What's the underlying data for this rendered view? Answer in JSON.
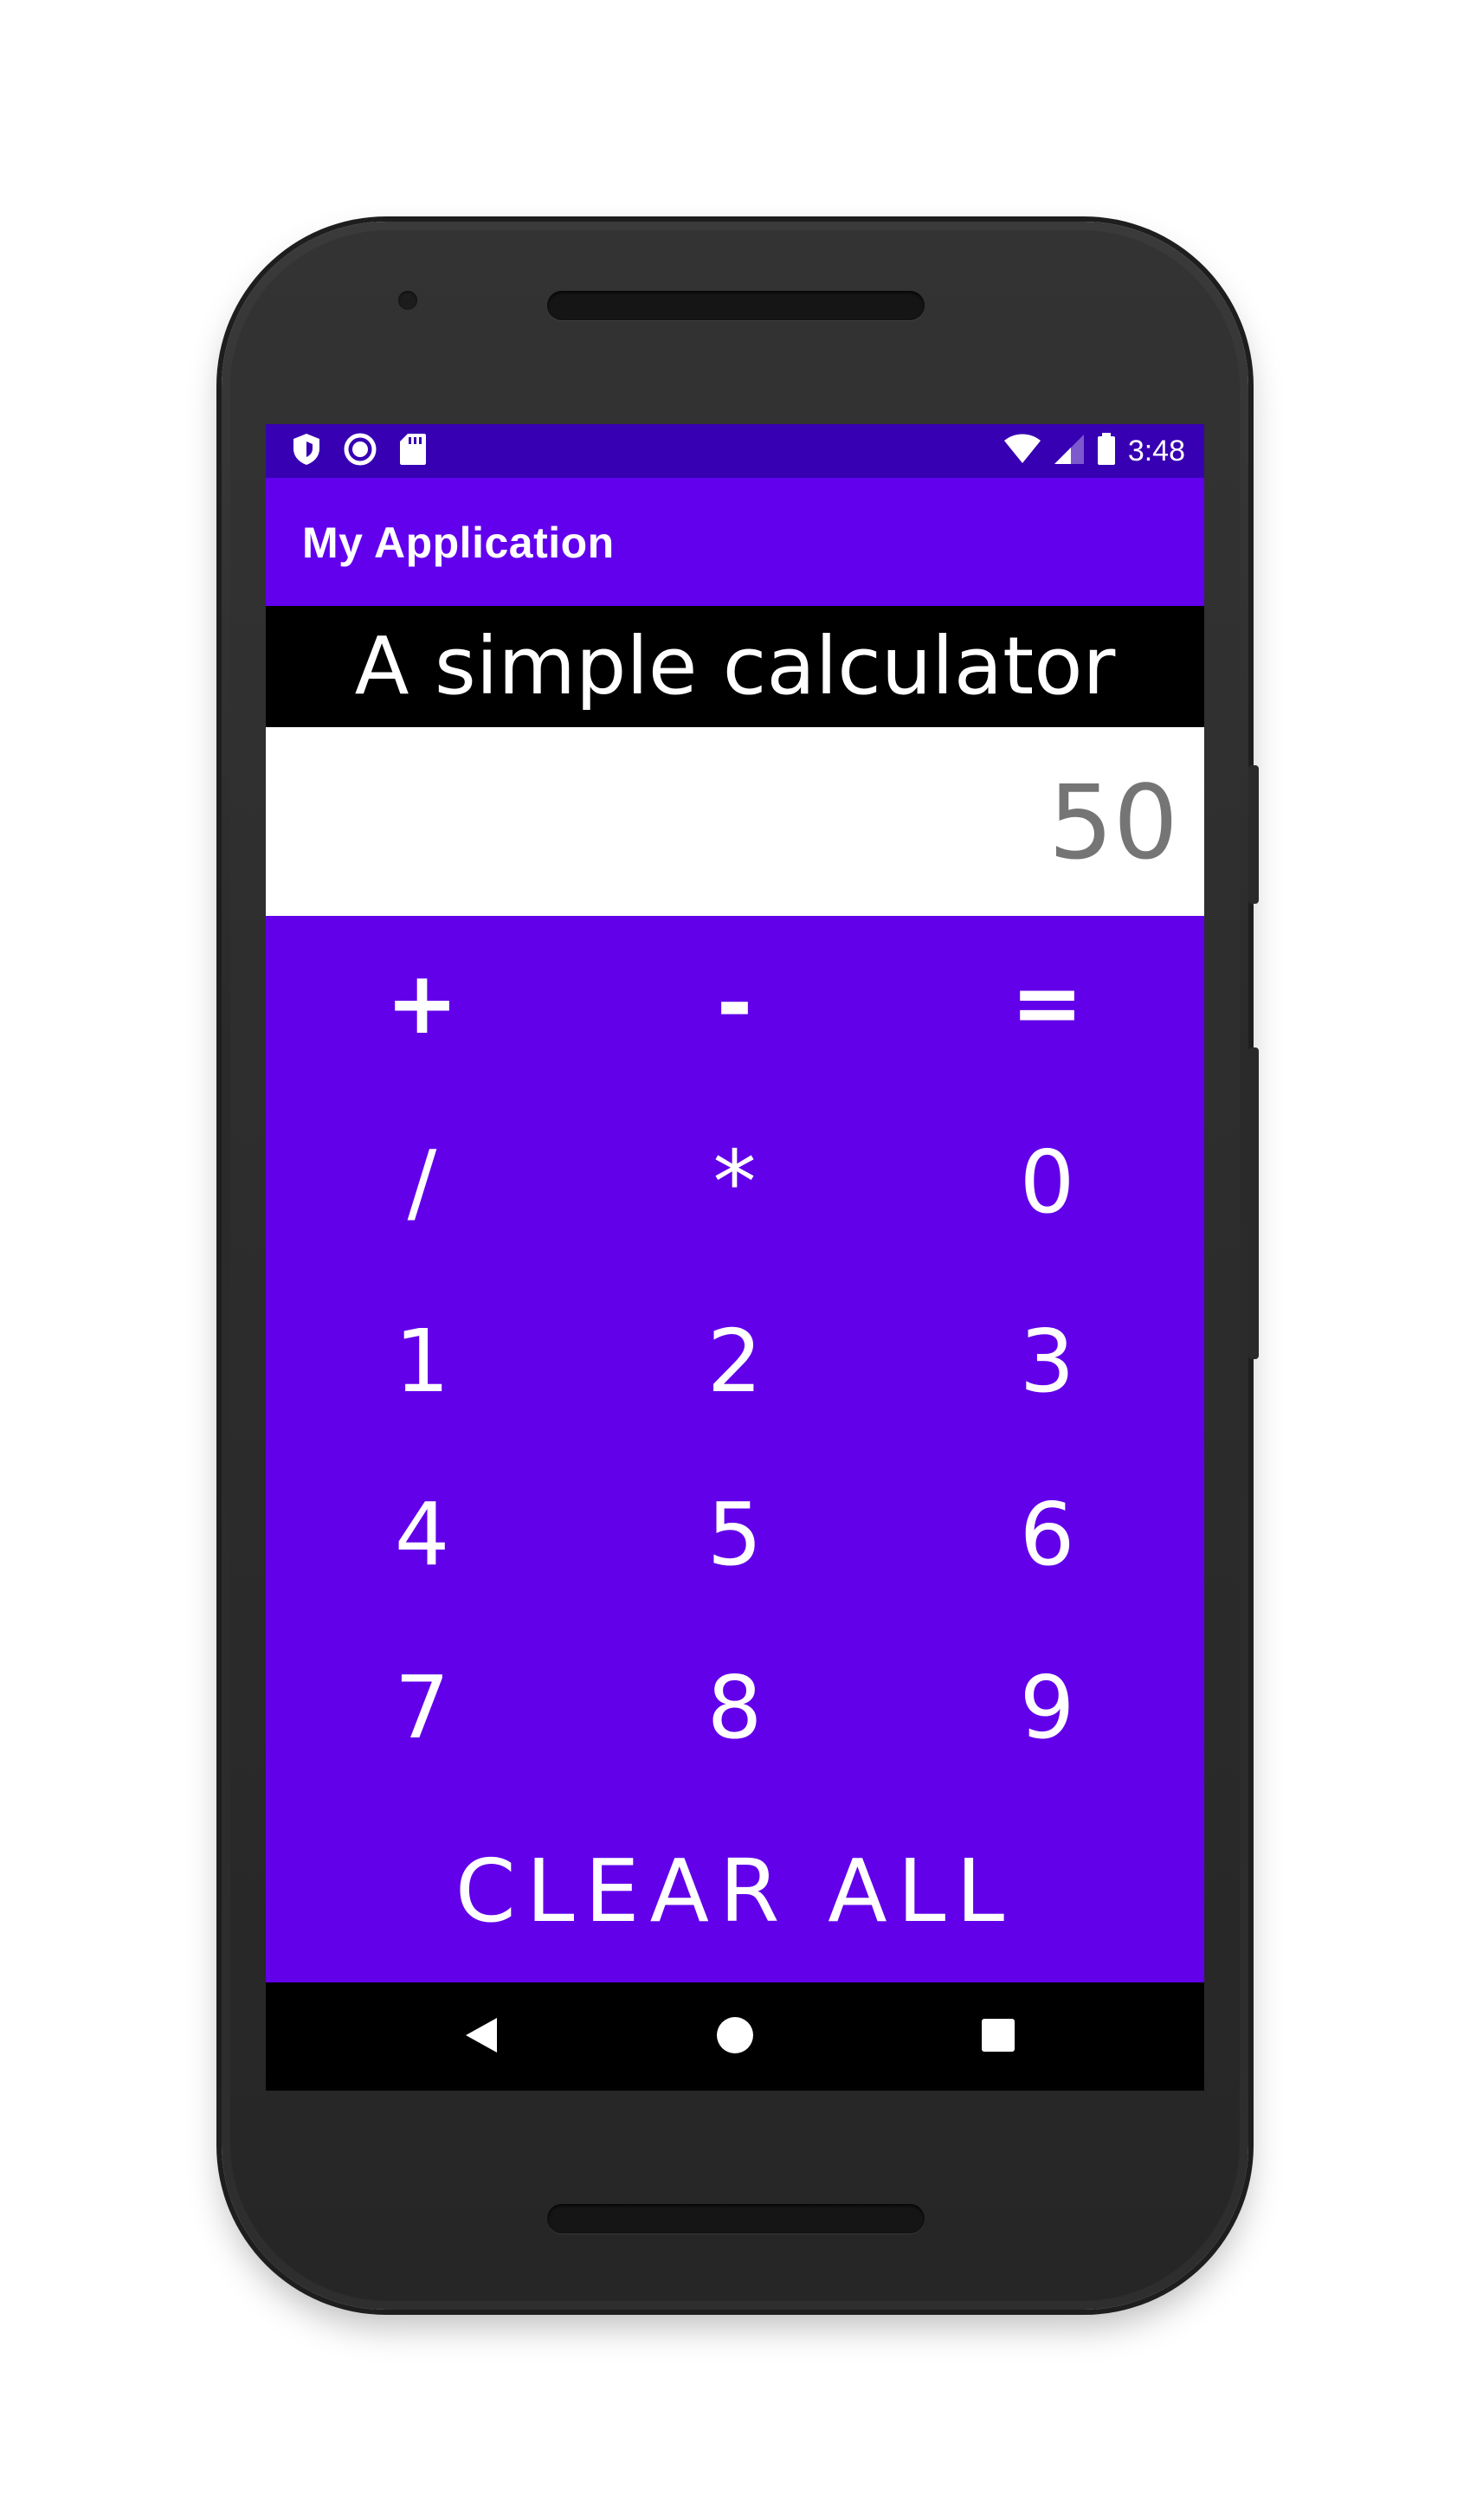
{
  "status_bar": {
    "time": "3:48",
    "icons_left": [
      "shield-icon",
      "circle-record-icon",
      "sd-card-icon"
    ],
    "icons_right": [
      "wifi-icon",
      "cell-signal-icon",
      "battery-icon"
    ]
  },
  "app_bar": {
    "title": "My Application"
  },
  "header": {
    "text": "A simple calculator"
  },
  "display": {
    "value": "50"
  },
  "keypad": {
    "keys": [
      "+",
      "-",
      "=",
      "/",
      "*",
      "0",
      "1",
      "2",
      "3",
      "4",
      "5",
      "6",
      "7",
      "8",
      "9"
    ],
    "clear_label": "CLEAR ALL"
  },
  "nav_bar": {
    "buttons": [
      "back-icon",
      "home-icon",
      "recents-icon"
    ]
  },
  "colors": {
    "status_bar": "#3700b3",
    "app_bar": "#6200ee",
    "keypad_bg": "#6200ea",
    "display_text": "#757575"
  }
}
